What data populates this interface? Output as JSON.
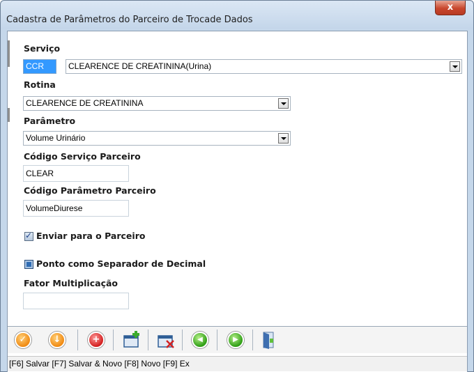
{
  "window": {
    "title": "Cadastra de Parâmetros do Parceiro de Trocade Dados",
    "close_glyph": "x"
  },
  "form": {
    "servico": {
      "label": "Serviço",
      "code": "CCR",
      "value": "CLEARENCE DE CREATININA(Urina)"
    },
    "rotina": {
      "label": "Rotina",
      "value": "CLEARENCE DE CREATININA"
    },
    "parametro": {
      "label": "Parâmetro",
      "value": "Volume Urinário"
    },
    "codigo_servico": {
      "label": "Código Serviço Parceiro",
      "value": "CLEAR"
    },
    "codigo_parametro": {
      "label": "Código Parâmetro Parceiro",
      "value": "VolumeDiurese"
    },
    "enviar": {
      "label": "Enviar para o Parceiro",
      "checked": true
    },
    "ponto": {
      "label": "Ponto como Separador de Decimal",
      "checked": true
    },
    "fator": {
      "label": "Fator Multiplicação",
      "value": ""
    }
  },
  "toolbar": {
    "buttons": [
      {
        "name": "save-icon",
        "glyph": "✓",
        "color": "orange"
      },
      {
        "name": "save-and-new-icon",
        "glyph": "↓",
        "color": "orange"
      },
      {
        "name": "new-icon",
        "glyph": "+",
        "color": "red"
      },
      {
        "name": "new-folder-icon",
        "glyph": "",
        "color": "folder-add"
      },
      {
        "name": "delete-folder-icon",
        "glyph": "",
        "color": "folder-delete"
      },
      {
        "name": "previous-icon",
        "glyph": "◀",
        "color": "green"
      },
      {
        "name": "next-icon",
        "glyph": "▶",
        "color": "green"
      },
      {
        "name": "exit-door-icon",
        "glyph": "",
        "color": "door"
      }
    ]
  },
  "status_bar": {
    "text": "[F6] Salvar [F7] Salvar & Novo [F8] Novo [F9] Ex"
  }
}
